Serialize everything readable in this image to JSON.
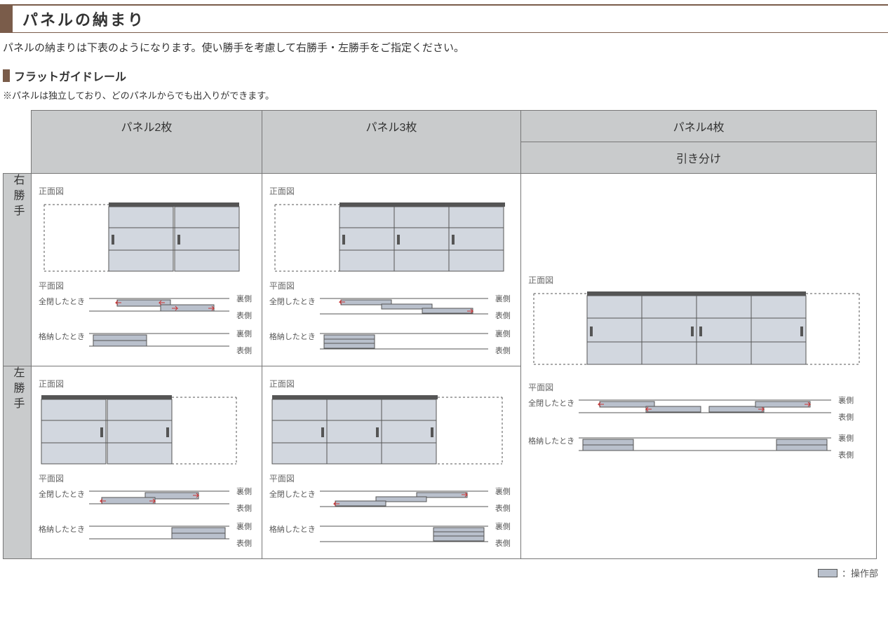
{
  "title": "パネルの納まり",
  "intro": "パネルの納まりは下表のようになります。使い勝手を考慮して右勝手・左勝手をご指定ください。",
  "subheading": "フラットガイドレール",
  "note": "※パネルは独立しており、どのパネルからでも出入りができます。",
  "headers": {
    "p2": "パネル2枚",
    "p3": "パネル3枚",
    "p4": "パネル4枚",
    "p4sub": "引き分け"
  },
  "rows": {
    "right": "右勝手",
    "left": "左勝手"
  },
  "labels": {
    "front": "正面図",
    "plan": "平面図",
    "closed": "全閉したとき",
    "stored": "格納したとき",
    "back": "裏側",
    "frontside": "表側"
  },
  "legend": "：操作部"
}
